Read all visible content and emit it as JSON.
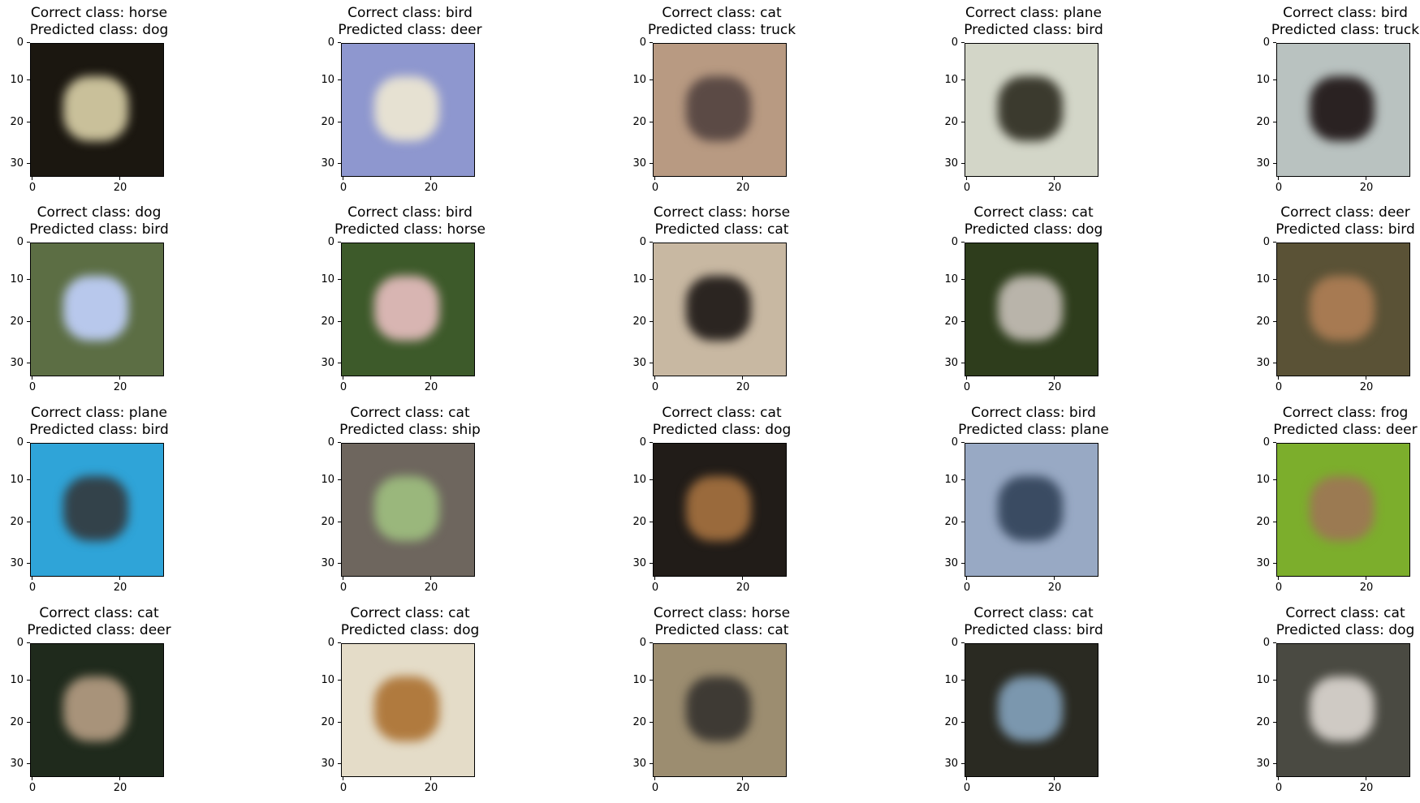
{
  "axis": {
    "y_ticks": [
      "0",
      "10",
      "20",
      "30"
    ],
    "x_ticks": [
      "0",
      "20"
    ]
  },
  "panels": [
    {
      "correct": "Correct class: horse",
      "predicted": "Predicted class: dog",
      "bg": "#1b1710",
      "fg": "#c9c09a"
    },
    {
      "correct": "Correct class: bird",
      "predicted": "Predicted class: deer",
      "bg": "#8e97cf",
      "fg": "#e6e1d2"
    },
    {
      "correct": "Correct class: cat",
      "predicted": "Predicted class: truck",
      "bg": "#b89a82",
      "fg": "#5b4a45"
    },
    {
      "correct": "Correct class: plane",
      "predicted": "Predicted class: bird",
      "bg": "#d3d6c8",
      "fg": "#3b3a2e"
    },
    {
      "correct": "Correct class: bird",
      "predicted": "Predicted class: truck",
      "bg": "#b9c2c0",
      "fg": "#2a2222"
    },
    {
      "correct": "Correct class: dog",
      "predicted": "Predicted class: bird",
      "bg": "#5c6e44",
      "fg": "#b8c8ec"
    },
    {
      "correct": "Correct class: bird",
      "predicted": "Predicted class: horse",
      "bg": "#3d5a2a",
      "fg": "#d8b5b2"
    },
    {
      "correct": "Correct class: horse",
      "predicted": "Predicted class: cat",
      "bg": "#c8b8a2",
      "fg": "#2b2521"
    },
    {
      "correct": "Correct class: cat",
      "predicted": "Predicted class: dog",
      "bg": "#2e3d1c",
      "fg": "#b9b4aa"
    },
    {
      "correct": "Correct class: deer",
      "predicted": "Predicted class: bird",
      "bg": "#5a5236",
      "fg": "#a77a52"
    },
    {
      "correct": "Correct class: plane",
      "predicted": "Predicted class: bird",
      "bg": "#2fa4d8",
      "fg": "#33424a"
    },
    {
      "correct": "Correct class: cat",
      "predicted": "Predicted class: ship",
      "bg": "#6e665e",
      "fg": "#9ab77c"
    },
    {
      "correct": "Correct class: cat",
      "predicted": "Predicted class: dog",
      "bg": "#211c18",
      "fg": "#9a6a3c"
    },
    {
      "correct": "Correct class: bird",
      "predicted": "Predicted class: plane",
      "bg": "#98a9c4",
      "fg": "#3a4b62"
    },
    {
      "correct": "Correct class: frog",
      "predicted": "Predicted class: deer",
      "bg": "#7cae2c",
      "fg": "#9b7a52"
    },
    {
      "correct": "Correct class: cat",
      "predicted": "Predicted class: deer",
      "bg": "#1f2a1c",
      "fg": "#a8937a"
    },
    {
      "correct": "Correct class: cat",
      "predicted": "Predicted class: dog",
      "bg": "#e4dcc8",
      "fg": "#b07a3e"
    },
    {
      "correct": "Correct class: horse",
      "predicted": "Predicted class: cat",
      "bg": "#9c8d70",
      "fg": "#3e3a34"
    },
    {
      "correct": "Correct class: cat",
      "predicted": "Predicted class: bird",
      "bg": "#2a2a22",
      "fg": "#7b97ae"
    },
    {
      "correct": "Correct class: cat",
      "predicted": "Predicted class: dog",
      "bg": "#4a4a42",
      "fg": "#cfcac4"
    }
  ]
}
